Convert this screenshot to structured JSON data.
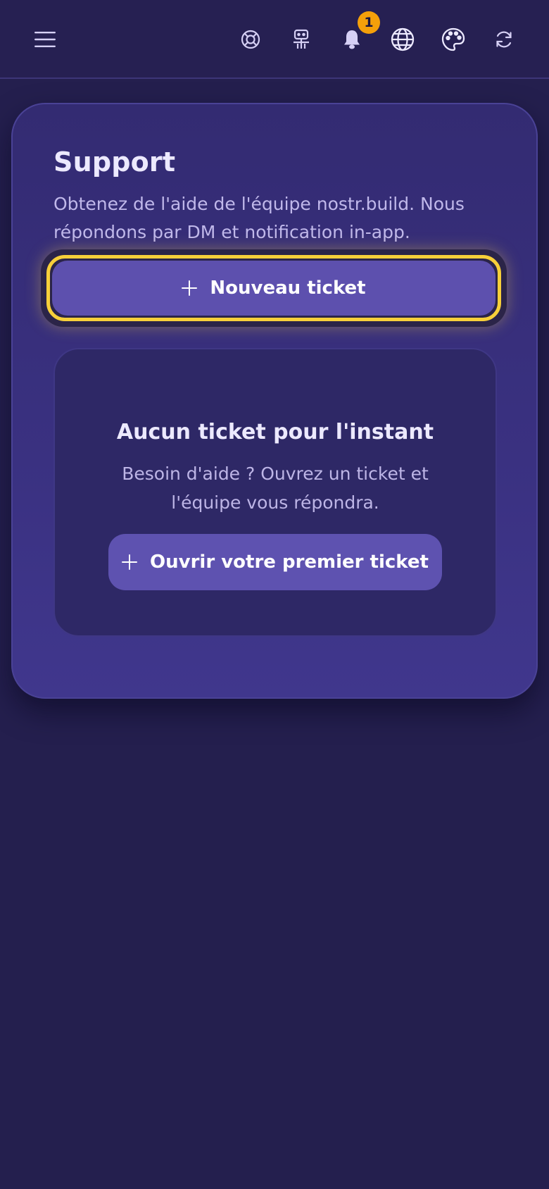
{
  "topbar": {
    "menu_icon": "hamburger-menu-icon",
    "icons": [
      "lifebuoy-icon",
      "robot-icon",
      "bell-icon",
      "globe-icon",
      "palette-icon",
      "refresh-icon"
    ],
    "notification_count": "1"
  },
  "support": {
    "title": "Support",
    "description": "Obtenez de l'aide de l'équipe nostr.build. Nous répondons par DM et notification in-app.",
    "new_ticket_label": "Nouveau ticket"
  },
  "empty_state": {
    "title": "Aucun ticket pour l'instant",
    "text": "Besoin d'aide ? Ouvrez un ticket et l'équipe vous répondra.",
    "button_label": "Ouvrir votre premier ticket"
  },
  "colors": {
    "background": "#241f4e",
    "card": "#3a3181",
    "accent_button": "#5d50ae",
    "highlight_ring": "#f7cf3a",
    "badge": "#f5a00a"
  }
}
